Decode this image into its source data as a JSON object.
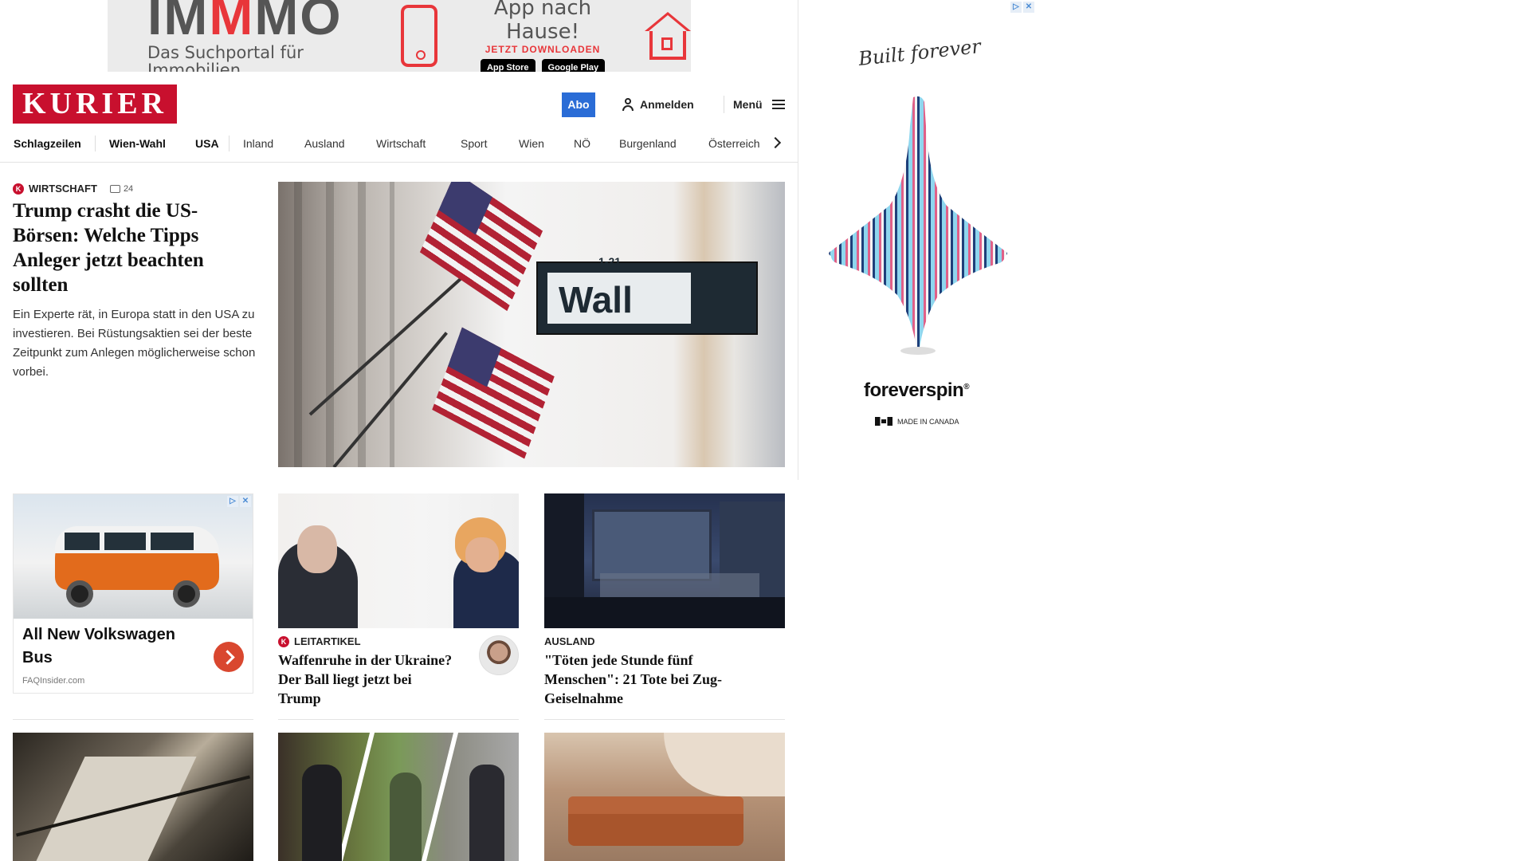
{
  "top_ad": {
    "logo_left": "IM",
    "logo_mid": "M",
    "logo_right": "MO",
    "tagline": "Das Suchportal für Immobilien",
    "headline": "App nach Hause!",
    "cta": "JETZT DOWNLOADEN",
    "store_apple": "App Store",
    "store_google": "Google Play"
  },
  "header": {
    "logo_text": "KURIER",
    "abo_label": "Abo",
    "login_label": "Anmelden",
    "menu_label": "Menü"
  },
  "nav": {
    "items": [
      {
        "label": "Schlagzeilen"
      },
      {
        "label": "Wien-Wahl"
      },
      {
        "label": "USA"
      },
      {
        "label": "Inland"
      },
      {
        "label": "Ausland"
      },
      {
        "label": "Wirtschaft"
      },
      {
        "label": "Sport"
      },
      {
        "label": "Wien"
      },
      {
        "label": "NÖ"
      },
      {
        "label": "Burgenland"
      },
      {
        "label": "Österreich"
      }
    ]
  },
  "lead": {
    "k_badge": "K",
    "category": "WIRTSCHAFT",
    "comments": "24",
    "title": "Trump crasht die US-Börsen: Welche Tipps Anleger jetzt beachten sollten",
    "teaser": "Ein Experte rät, in Europa statt in den USA zu investieren. Bei Rüstungsaktien sei der beste Zeitpunkt zum Anlegen möglicherweise schon vorbei.",
    "image_sign_text": "Wall",
    "image_sign_small": "1-21"
  },
  "right_ad": {
    "script": "Built forever",
    "brand": "foreverspin",
    "brand_mark": "®",
    "made_in": "MADE IN CANADA"
  },
  "vw_ad": {
    "title": "All New Volkswagen Bus",
    "source": "FAQInsider.com"
  },
  "cards": [
    {
      "k_badge": "K",
      "category": "LEITARTIKEL",
      "title": "Waffenruhe in der Ukraine? Der Ball liegt jetzt bei Trump"
    },
    {
      "category": "AUSLAND",
      "title": "\"Töten jede Stunde fünf Menschen\": 21 Tote bei Zug-Geiselnahme"
    }
  ],
  "colors": {
    "brand_red": "#c8102e",
    "abo_blue": "#2a6cd6",
    "ad_red": "#e8363a"
  }
}
